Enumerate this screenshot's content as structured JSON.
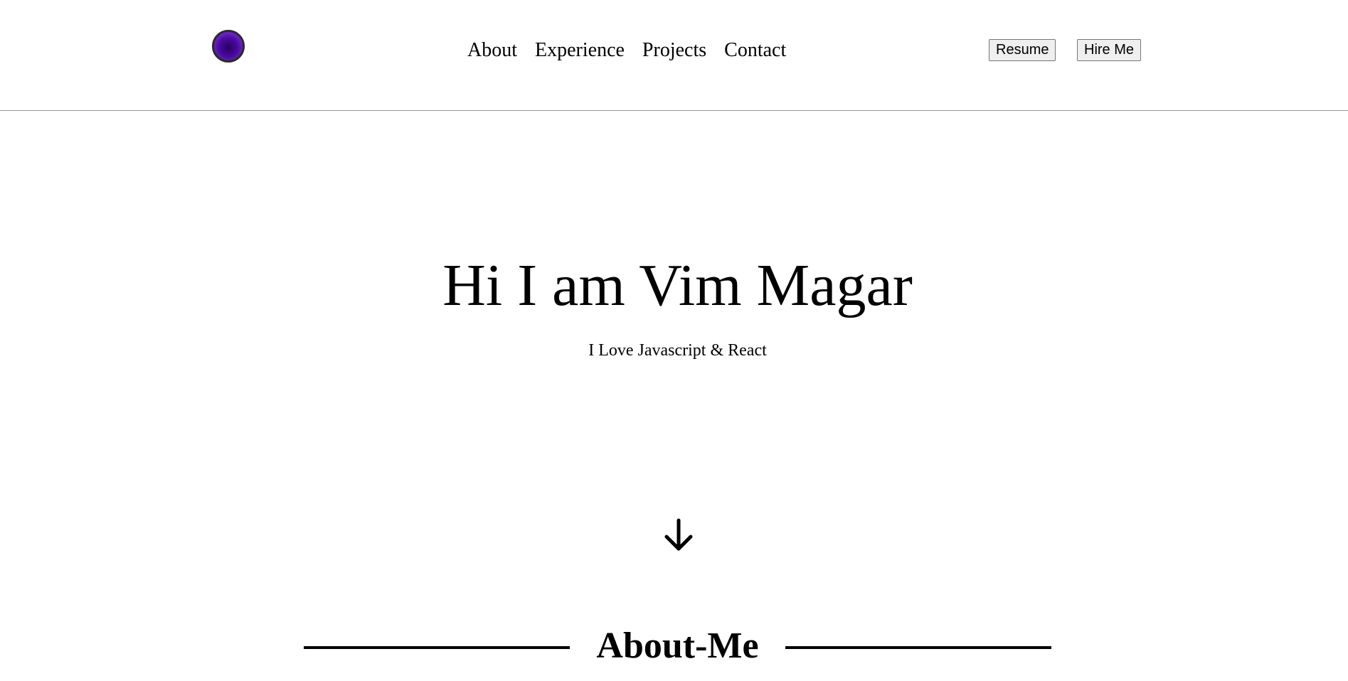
{
  "header": {
    "logo_colors": {
      "center": "#2a0060",
      "rim": "#9a55e0",
      "border": "#2a2a2a"
    },
    "nav": [
      {
        "label": "About"
      },
      {
        "label": "Experience"
      },
      {
        "label": "Projects"
      },
      {
        "label": "Contact"
      }
    ],
    "buttons": {
      "resume_label": "Resume",
      "hire_label": "Hire Me"
    }
  },
  "hero": {
    "title": "Hi I am Vim Magar",
    "subtitle": "I Love Javascript & React",
    "scroll_icon": "arrow-down-icon"
  },
  "about": {
    "heading": "About-Me"
  }
}
